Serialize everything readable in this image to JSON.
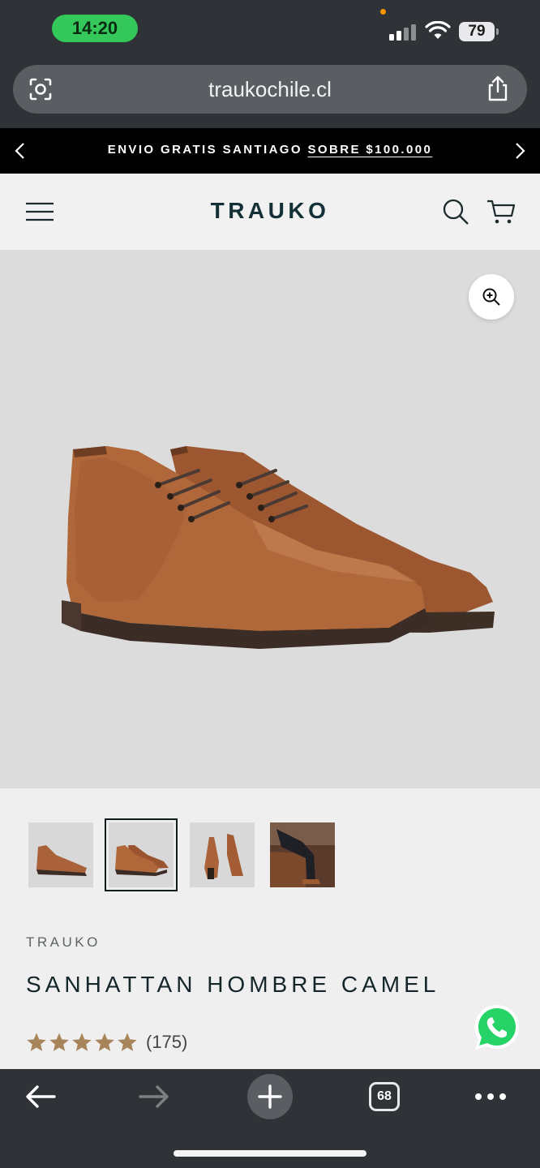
{
  "status_bar": {
    "time": "14:20",
    "battery": "79"
  },
  "browser": {
    "url": "traukochile.cl",
    "open_tabs": "68"
  },
  "announcement": {
    "text": "ENVIO GRATIS SANTIAGO",
    "link": "SOBRE $100.000"
  },
  "header": {
    "logo": "TRAUKO"
  },
  "product": {
    "brand": "TRAUKO",
    "title": "SANHATTAN HOMBRE CAMEL",
    "rating": 5,
    "reviews": "(175)",
    "thumbnails": [
      "boot-pair-side",
      "boot-pair-angle",
      "boot-sole-top",
      "lifestyle-photo"
    ],
    "active_thumbnail": 1
  },
  "colors": {
    "accent_green": "#34c759",
    "star": "#a8845a",
    "logo": "#133036",
    "whatsapp": "#25d366"
  },
  "icons": [
    "lens-icon",
    "share-icon",
    "chevron-left-icon",
    "chevron-right-icon",
    "menu-icon",
    "search-icon",
    "cart-icon",
    "zoom-in-icon",
    "star-icon",
    "whatsapp-icon",
    "back-arrow-icon",
    "forward-arrow-icon",
    "plus-icon",
    "ellipsis-icon"
  ]
}
